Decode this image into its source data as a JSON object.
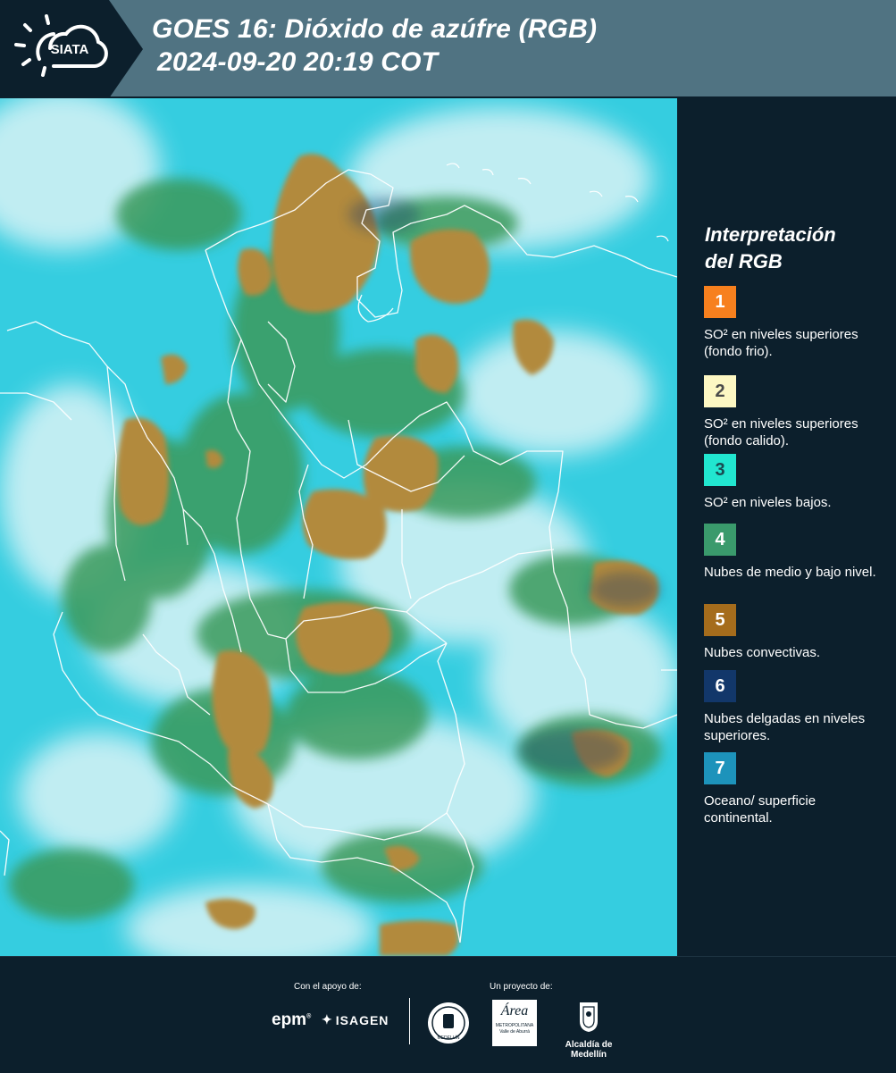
{
  "header": {
    "logo_text": "SIATA",
    "title_line1": "GOES 16: Dióxido de azúfre (RGB)",
    "title_line2": "2024-09-20 20:19 COT"
  },
  "legend": {
    "title_line1": "Interpretación",
    "title_line2": "del RGB",
    "items": [
      {
        "num": "1",
        "color": "#f7801e",
        "numcolor": "#ffffff",
        "text": "SO² en niveles superiores (fondo frio)."
      },
      {
        "num": "2",
        "color": "#fdf7c3",
        "numcolor": "#4a4a4a",
        "text": "SO² en niveles superiores (fondo calido)."
      },
      {
        "num": "3",
        "color": "#21e6d0",
        "numcolor": "#1a4a50",
        "text": "SO² en niveles bajos."
      },
      {
        "num": "4",
        "color": "#3a9a6c",
        "numcolor": "#ffffff",
        "text": "Nubes de medio y bajo nivel."
      },
      {
        "num": "5",
        "color": "#a56c1c",
        "numcolor": "#ffffff",
        "text": "Nubes convectivas."
      },
      {
        "num": "6",
        "color": "#12376a",
        "numcolor": "#ffffff",
        "text": "Nubes delgadas en niveles superiores."
      },
      {
        "num": "7",
        "color": "#1d93bb",
        "numcolor": "#ffffff",
        "text": "Oceano/ superficie continental."
      }
    ]
  },
  "map": {
    "ocean_color": "#35cde0",
    "cloud_color": "#bfe9ef",
    "vegetation_color": "#3c9a5a",
    "convective_color": "#b0853e",
    "border_color": "#ffffff"
  },
  "footer": {
    "support_label": "Con el apoyo de:",
    "project_label": "Un proyecto de:",
    "epm": "epm",
    "isagen": "ISAGEN",
    "area_title": "Área",
    "area_sub1": "METROPOLITANA",
    "area_sub2": "Valle de Aburrá",
    "alcaldia": "Alcaldía de Medellín",
    "seal_text": "MEDELLÍN"
  }
}
